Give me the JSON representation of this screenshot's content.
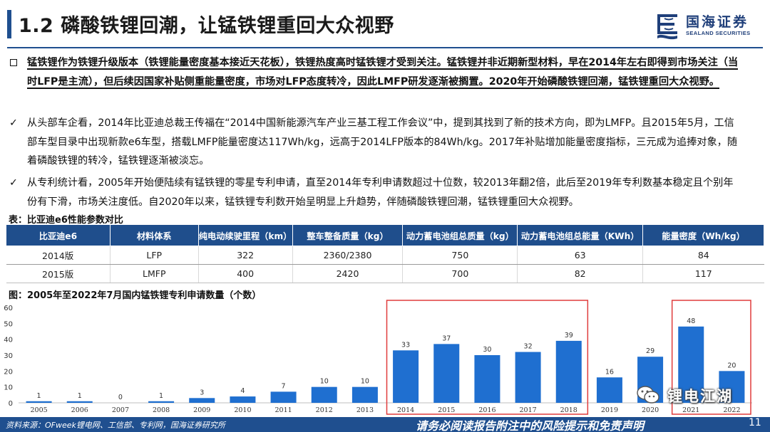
{
  "header": {
    "title": "1.2 磷酸铁锂回潮，让锰铁锂重回大众视野",
    "logo_cn": "国海证券",
    "logo_en": "SEALAND SECURITIES"
  },
  "paragraphs": {
    "p1": "锰铁锂作为铁锂升级版本（铁锂能量密度基本接近天花板），铁锂热度高时锰铁锂才受到关注。锰铁锂并非近期新型材料，早在2014年左右即得到市场关注（当时LFP是主流），但后续因国家补贴侧重能量密度，市场对LFP态度转冷，因此LMFP研发逐渐被搁置。2020年开始磷酸铁锂回潮，锰铁锂重回大众视野。",
    "p2": "从头部车企看，2014年比亚迪总裁王传福在“2014中国新能源汽车产业三基工程工作会议”中，提到其找到了新的技术方向，即为LMFP。且2015年5月，工信部车型目录中出现新款e6车型，搭载LMFP能量密度达117Wh/kg，远高于2014LFP版本的84Wh/kg。2017年补贴增加能量密度指标，三元成为追捧对象，随着磷酸铁锂的转冷，锰铁锂逐渐被淡忘。",
    "p3": "从专利统计看，2005年开始便陆续有锰铁锂的零星专利申请，直至2014年专利申请数超过十位数，较2013年翻2倍，此后至2019年专利数基本稳定且个别年份有下滑，市场关注度低。自2020年以来，锰铁锂专利数开始呈明显上升趋势，伴随磷酸铁锂回潮，锰铁锂重回大众视野。",
    "check_symbol": "✓"
  },
  "table": {
    "caption": "表：比亚迪e6性能参数对比",
    "headers": [
      "比亚迪e6",
      "材料体系",
      "纯电动续驶里程（km）",
      "整车整备质量（kg）",
      "动力蓄电池组总质量（kg）",
      "动力蓄电池组总能量（KWh）",
      "能量密度（Wh/kg）"
    ],
    "rows": [
      [
        "2014版",
        "LFP",
        "322",
        "2360/2380",
        "750",
        "63",
        "84"
      ],
      [
        "2015版",
        "LMFP",
        "400",
        "2420",
        "700",
        "82",
        "117"
      ]
    ]
  },
  "chart_title": "图：2005年至2022年7月国内锰铁锂专利申请数量（个数）",
  "chart_data": {
    "type": "bar",
    "categories": [
      "2005",
      "2006",
      "2007",
      "2008",
      "2009",
      "2010",
      "2011",
      "2012",
      "2013",
      "2014",
      "2015",
      "2016",
      "2017",
      "2018",
      "2019",
      "2020",
      "2021",
      "2022"
    ],
    "values": [
      1,
      1,
      0,
      1,
      3,
      4,
      7,
      10,
      10,
      33,
      37,
      30,
      32,
      39,
      16,
      29,
      48,
      20
    ],
    "ylim": [
      0,
      60
    ],
    "yticks": [
      "0",
      "10",
      "20",
      "30",
      "40",
      "50",
      "60"
    ],
    "bar_color": "#1f6fd0",
    "highlight_color": "#e03c3c",
    "highlight_groups": [
      [
        "2014",
        "2018"
      ],
      [
        "2021",
        "2022"
      ]
    ]
  },
  "watermark": {
    "text": "锂电江湖"
  },
  "footer": {
    "source": "资料来源：OFweek锂电网、工信部、专利网，国海证券研究所",
    "disclaimer": "请务必阅读报告附注中的风险提示和免责声明",
    "page": "11"
  }
}
